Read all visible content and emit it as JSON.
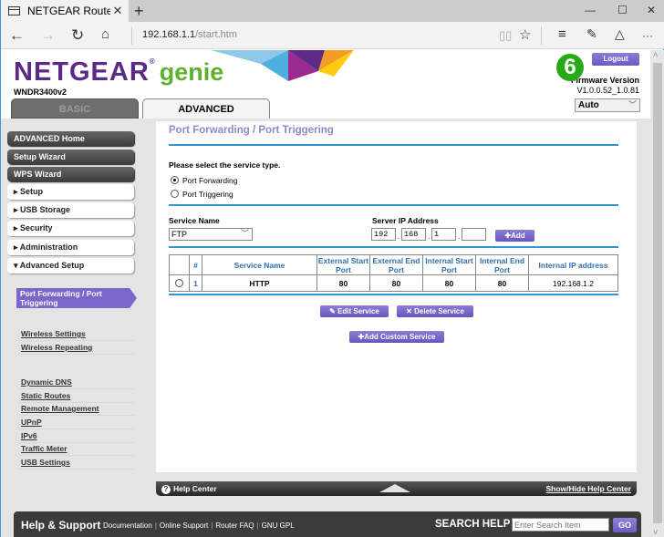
{
  "browser": {
    "tab_title": "NETGEAR Router WNDF",
    "url_host": "192.168.1.1",
    "url_path": "/start.htm",
    "new_tab": "+",
    "tab_close": "✕",
    "minimize": "—",
    "maximize": "☐",
    "close": "✕",
    "more": "···"
  },
  "header": {
    "brand": "NETGEAR",
    "brand_mark": "®",
    "product": "genie",
    "model": "WNDR3400v2",
    "logout_label": "Logout",
    "step_badge": "6",
    "firmware_label": "Firmware Version",
    "firmware_version": "V1.0.0.52_1.0.81",
    "language": "Auto",
    "tabs": {
      "basic": "BASIC",
      "advanced": "ADVANCED"
    }
  },
  "sidebar": {
    "top_items": [
      "ADVANCED Home",
      "Setup Wizard",
      "WPS Wizard"
    ],
    "sections": [
      {
        "label": "Setup",
        "arrow": "▸"
      },
      {
        "label": "USB Storage",
        "arrow": "▸"
      },
      {
        "label": "Security",
        "arrow": "▸"
      },
      {
        "label": "Administration",
        "arrow": "▸"
      },
      {
        "label": "Advanced Setup",
        "arrow": "▾"
      }
    ],
    "sub_items": [
      "Wireless Settings",
      "Wireless Repeating",
      "Port Forwarding / Port Triggering",
      "Dynamic DNS",
      "Static Routes",
      "Remote Management",
      "UPnP",
      "IPv6",
      "Traffic Meter",
      "USB Settings"
    ],
    "active_sub": "Port Forwarding / Port Triggering"
  },
  "main": {
    "title": "Port Forwarding / Port Triggering",
    "prompt": "Please select the service type.",
    "service_types": [
      {
        "label": "Port Forwarding",
        "selected": true
      },
      {
        "label": "Port Triggering",
        "selected": false
      }
    ],
    "service_name_label": "Service Name",
    "service_name_value": "FTP",
    "server_ip_label": "Server IP Address",
    "server_ip": [
      "192",
      "168",
      "1",
      ""
    ],
    "add_label": "Add",
    "table": {
      "headers": [
        "",
        "#",
        "Service Name",
        "External Start Port",
        "External End Port",
        "Internal Start Port",
        "Internal End Port",
        "Internal IP address"
      ],
      "rows": [
        {
          "num": "1",
          "service": "HTTP",
          "ext_start": "80",
          "ext_end": "80",
          "int_start": "80",
          "int_end": "80",
          "ip": "192.168.1.2"
        }
      ]
    },
    "edit_label": "Edit Service",
    "delete_label": "Delete Service",
    "add_custom_label": "Add Custom Service"
  },
  "help_center": {
    "label": "Help Center",
    "toggle": "Show/Hide Help Center"
  },
  "footer": {
    "title": "Help & Support",
    "links": [
      "Documentation",
      "Online Support",
      "Router FAQ",
      "GNU GPL"
    ],
    "search_label": "SEARCH HELP",
    "search_placeholder": "Enter Search Item",
    "go_label": "GO"
  }
}
